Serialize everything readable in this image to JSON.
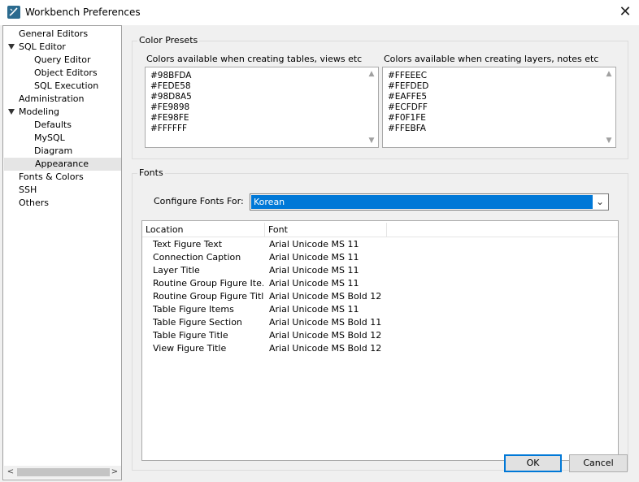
{
  "window": {
    "title": "Workbench Preferences",
    "close_glyph": "✕"
  },
  "tree": {
    "items": [
      {
        "label": "General Editors",
        "level": 0,
        "expander": false
      },
      {
        "label": "SQL Editor",
        "level": 0,
        "expander": true
      },
      {
        "label": "Query Editor",
        "level": 1,
        "expander": false
      },
      {
        "label": "Object Editors",
        "level": 1,
        "expander": false
      },
      {
        "label": "SQL Execution",
        "level": 1,
        "expander": false
      },
      {
        "label": "Administration",
        "level": 0,
        "expander": false
      },
      {
        "label": "Modeling",
        "level": 0,
        "expander": true
      },
      {
        "label": "Defaults",
        "level": 1,
        "expander": false
      },
      {
        "label": "MySQL",
        "level": 1,
        "expander": false
      },
      {
        "label": "Diagram",
        "level": 1,
        "expander": false
      },
      {
        "label": "Appearance",
        "level": 1,
        "expander": false,
        "selected": true
      },
      {
        "label": "Fonts & Colors",
        "level": 0,
        "expander": false
      },
      {
        "label": "SSH",
        "level": 0,
        "expander": false
      },
      {
        "label": "Others",
        "level": 0,
        "expander": false
      }
    ],
    "scroll_left": "<",
    "scroll_right": ">"
  },
  "color_presets": {
    "title": "Color Presets",
    "tables_label": "Colors available when creating tables, views etc",
    "tables_colors": "#98BFDA\n#FEDE58\n#98D8A5\n#FE9898\n#FE98FE\n#FFFFFF",
    "layers_label": "Colors available when creating layers, notes etc",
    "layers_colors": "#FFEEEC\n#FEFDED\n#EAFFE5\n#ECFDFF\n#F0F1FE\n#FFEBFA"
  },
  "fonts": {
    "title": "Fonts",
    "configure_label": "Configure Fonts For:",
    "configure_value": "Korean",
    "columns": [
      "Location",
      "Font"
    ],
    "rows": [
      [
        "Text Figure Text",
        "Arial Unicode MS 11"
      ],
      [
        "Connection Caption",
        "Arial Unicode MS 11"
      ],
      [
        "Layer Title",
        "Arial Unicode MS 11"
      ],
      [
        "Routine Group Figure Ite...",
        "Arial Unicode MS 11"
      ],
      [
        "Routine Group Figure Title",
        "Arial Unicode MS Bold 12"
      ],
      [
        "Table Figure Items",
        "Arial Unicode MS 11"
      ],
      [
        "Table Figure Section",
        "Arial Unicode MS Bold 11"
      ],
      [
        "Table Figure Title",
        "Arial Unicode MS Bold 12"
      ],
      [
        "View Figure Title",
        "Arial Unicode MS Bold 12"
      ]
    ]
  },
  "buttons": {
    "ok": "OK",
    "cancel": "Cancel"
  },
  "colors": {
    "accent": "#0078d7",
    "selection_gray": "#e5e5e5",
    "dialog_bg": "#f0f0f0"
  }
}
